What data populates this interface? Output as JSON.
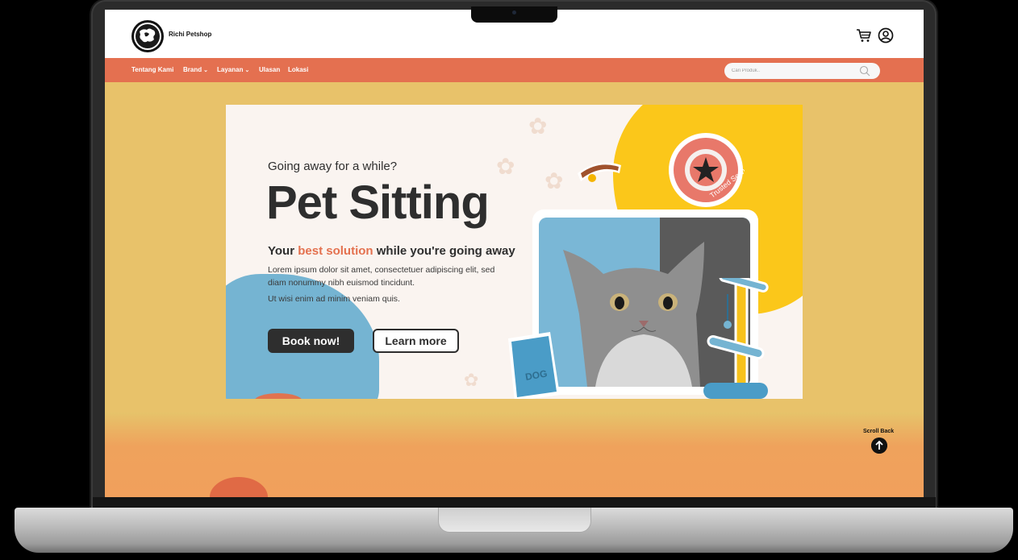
{
  "header": {
    "brand_name": "Richi Petshop",
    "cart_icon": "cart-icon",
    "user_icon": "user-circle-icon"
  },
  "nav": {
    "items": [
      {
        "label": "Tentang Kami",
        "dropdown": false
      },
      {
        "label": "Brand",
        "dropdown": true
      },
      {
        "label": "Layanan",
        "dropdown": true
      },
      {
        "label": "Ulasan",
        "dropdown": false
      },
      {
        "label": "Lokasi",
        "dropdown": false
      }
    ],
    "search_placeholder": "Cari Produk..",
    "search_icon": "search-icon"
  },
  "banner": {
    "subtitle": "Going away for a while?",
    "title": "Pet Sitting",
    "tagline_start": "Your ",
    "tagline_accent": "best solution",
    "tagline_end": " while you're going away",
    "body1": "Lorem ipsum dolor sit amet, consectetuer adipiscing elit, sed diam nonummy nibh euismod tincidunt.",
    "body2": "Ut wisi enim ad minim veniam quis.",
    "book_label": "Book now!",
    "learn_label": "Learn more",
    "badge_text": "Trusted Service",
    "bag_text": "DOG"
  },
  "scroll": {
    "label": "Scroll Back",
    "icon": "arrow-up-icon"
  },
  "colors": {
    "nav_bg": "#e47050",
    "accent": "#e4714f",
    "page_bg": "#e8c26a",
    "dark": "#2e2e2e",
    "yellow": "#fbc71a",
    "blue": "#75b4d2"
  }
}
